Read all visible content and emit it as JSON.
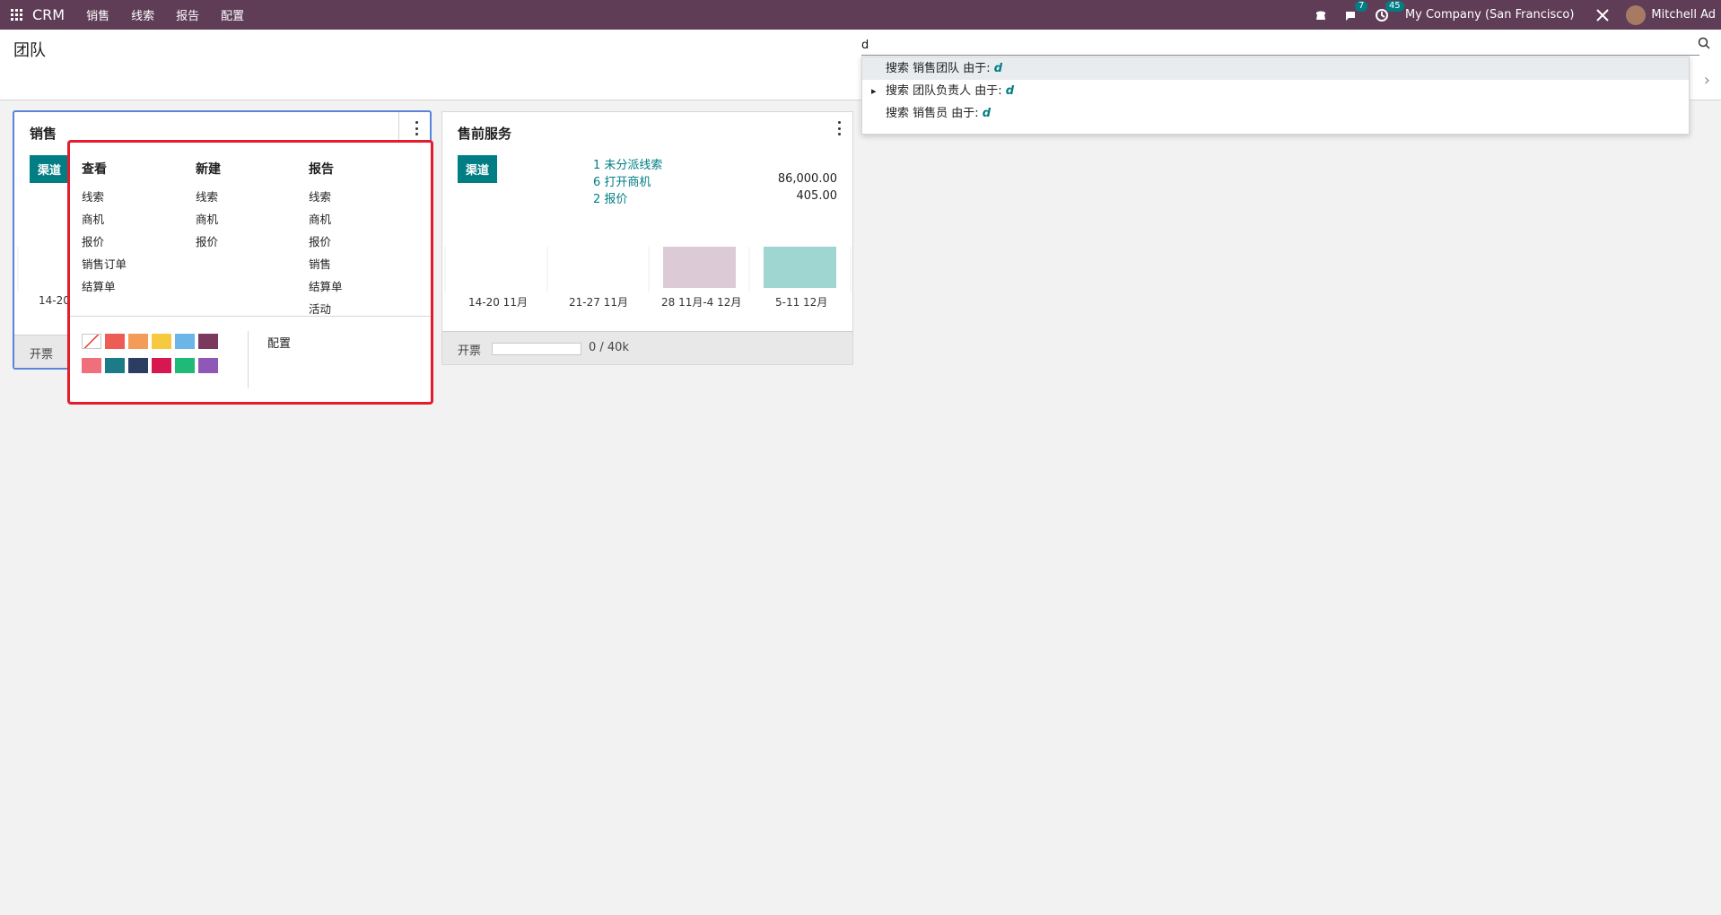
{
  "app": {
    "name": "CRM",
    "menu": [
      "销售",
      "线索",
      "报告",
      "配置"
    ]
  },
  "topbar": {
    "message_count": "7",
    "activity_count": "45",
    "company": "My Company (San Francisco)",
    "user": "Mitchell Ad",
    "icons": [
      "phone-icon",
      "chat-icon",
      "clock-icon",
      "tools-icon"
    ]
  },
  "page": {
    "title": "团队"
  },
  "search": {
    "value": "d",
    "items": [
      {
        "prefix": "搜索 销售团队 由于:",
        "term": "d"
      },
      {
        "prefix": "搜索 团队负责人 由于:",
        "term": "d"
      },
      {
        "prefix": "搜索 销售员 由于:",
        "term": "d"
      }
    ]
  },
  "cards": {
    "sales": {
      "title": "销售",
      "pipeline_button": "渠道",
      "first_label": "14-20",
      "footer_label": "开票"
    },
    "presales": {
      "title": "售前服务",
      "pipeline_button": "渠道",
      "links": [
        {
          "label": "1 未分派线索",
          "value": ""
        },
        {
          "label": "6 打开商机",
          "value": "86,000.00"
        },
        {
          "label": "2 报价",
          "value": "405.00"
        }
      ],
      "chart_labels": [
        "14-20 11月",
        "21-27 11月",
        "28 11月-4 12月",
        "5-11 12月"
      ],
      "footer_label": "开票",
      "progress_fraction": 0,
      "progress_text": "0 / 40k"
    }
  },
  "context_menu": {
    "view": {
      "title": "查看",
      "items": [
        "线索",
        "商机",
        "报价",
        "销售订单",
        "结算单"
      ]
    },
    "new": {
      "title": "新建",
      "items": [
        "线索",
        "商机",
        "报价"
      ]
    },
    "report": {
      "title": "报告",
      "items": [
        "线索",
        "商机",
        "报价",
        "销售",
        "结算单",
        "活动"
      ]
    },
    "settings": "配置",
    "colors": [
      "none",
      "#ee5d55",
      "#f39c5a",
      "#f7c93e",
      "#6bb5e8",
      "#7b3a5d",
      "#ef6f7a",
      "#1b7c88",
      "#2b3d63",
      "#d7174f",
      "#1fb978",
      "#8e57b8"
    ]
  }
}
